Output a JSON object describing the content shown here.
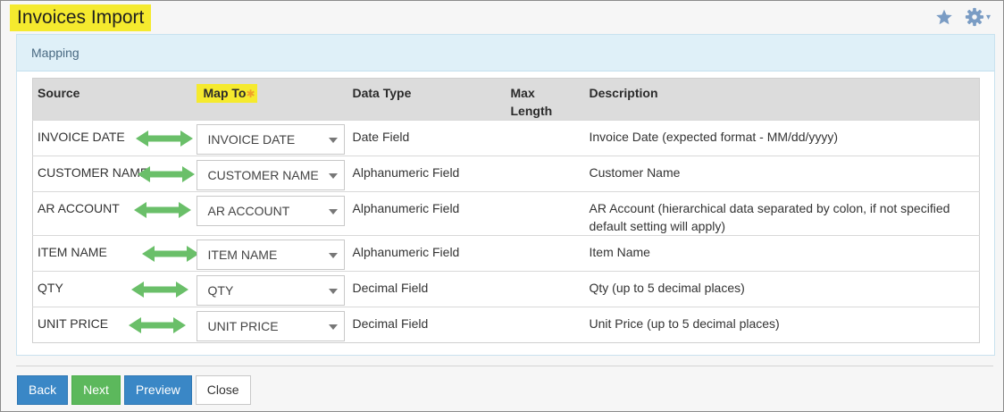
{
  "header": {
    "title": "Invoices Import",
    "icons": [
      "star-icon",
      "gear-icon",
      "chevron-down-icon"
    ],
    "caret": "▾"
  },
  "panel": {
    "title": "Mapping"
  },
  "table": {
    "headers": {
      "source": "Source",
      "map_to": "Map To",
      "required_marker": "✱",
      "data_type": "Data Type",
      "max_length_line1": "Max",
      "max_length_line2": "Length",
      "description": "Description"
    },
    "rows": [
      {
        "source": "INVOICE DATE",
        "map_to": "INVOICE DATE",
        "data_type": "Date Field",
        "max_length": "",
        "description": "Invoice Date (expected format - MM/dd/yyyy)"
      },
      {
        "source": "CUSTOMER NAME",
        "map_to": "CUSTOMER NAME",
        "data_type": "Alphanumeric Field",
        "max_length": "",
        "description": "Customer Name"
      },
      {
        "source": "AR ACCOUNT",
        "map_to": "AR ACCOUNT",
        "data_type": "Alphanumeric Field",
        "max_length": "",
        "description": "AR Account (hierarchical data separated by colon, if not specified default setting will apply)"
      },
      {
        "source": "ITEM NAME",
        "map_to": "ITEM NAME",
        "data_type": "Alphanumeric Field",
        "max_length": "",
        "description": "Item Name"
      },
      {
        "source": "QTY",
        "map_to": "QTY",
        "data_type": "Decimal Field",
        "max_length": "",
        "description": "Qty (up to 5 decimal places)"
      },
      {
        "source": "UNIT PRICE",
        "map_to": "UNIT PRICE",
        "data_type": "Decimal Field",
        "max_length": "",
        "description": "Unit Price (up to 5 decimal places)"
      }
    ]
  },
  "buttons": {
    "back": "Back",
    "next": "Next",
    "preview": "Preview",
    "close": "Close"
  },
  "colors": {
    "highlight": "#f5ea2e",
    "primary": "#3a87c6",
    "success": "#5cb85c",
    "arrow": "#6abf69"
  }
}
